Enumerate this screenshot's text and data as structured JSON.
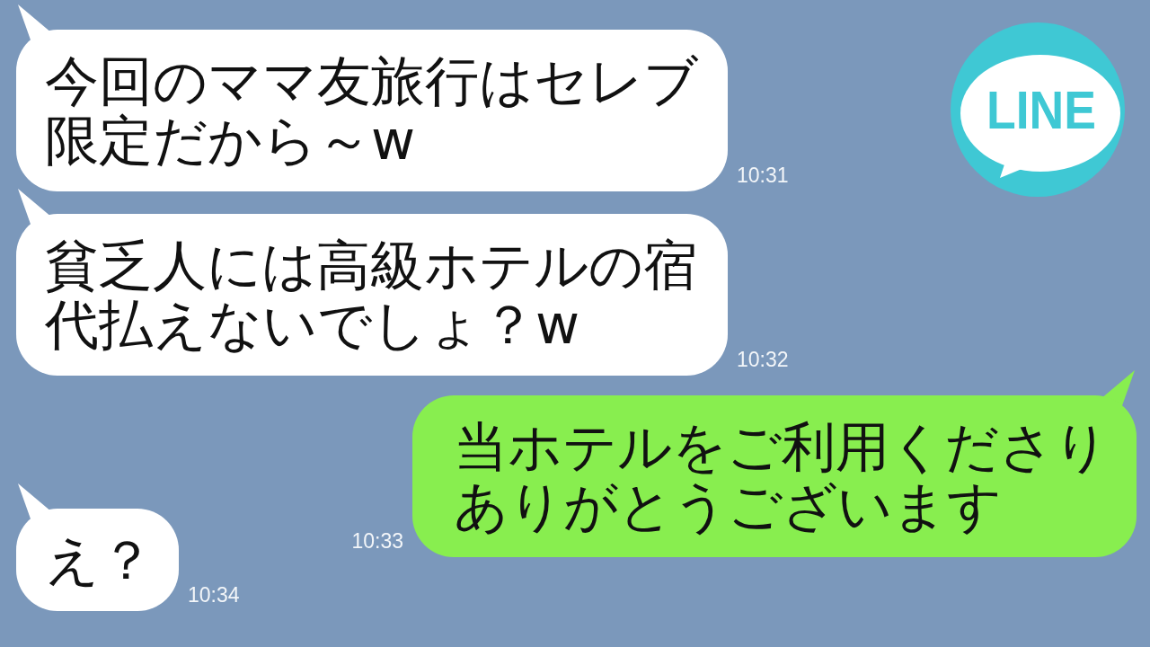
{
  "logo": {
    "text": "LINE"
  },
  "messages": [
    {
      "kind": "received",
      "text": "今回のママ友旅行はセレブ限定だから～w",
      "time": "10:31"
    },
    {
      "kind": "received",
      "text": "貧乏人には高級ホテルの宿代払えないでしょ？w",
      "time": "10:32"
    },
    {
      "kind": "sent",
      "text": "当ホテルをご利用くださりありがとうございます",
      "time": "10:33"
    },
    {
      "kind": "received",
      "text": "え？",
      "time": "10:34"
    }
  ]
}
